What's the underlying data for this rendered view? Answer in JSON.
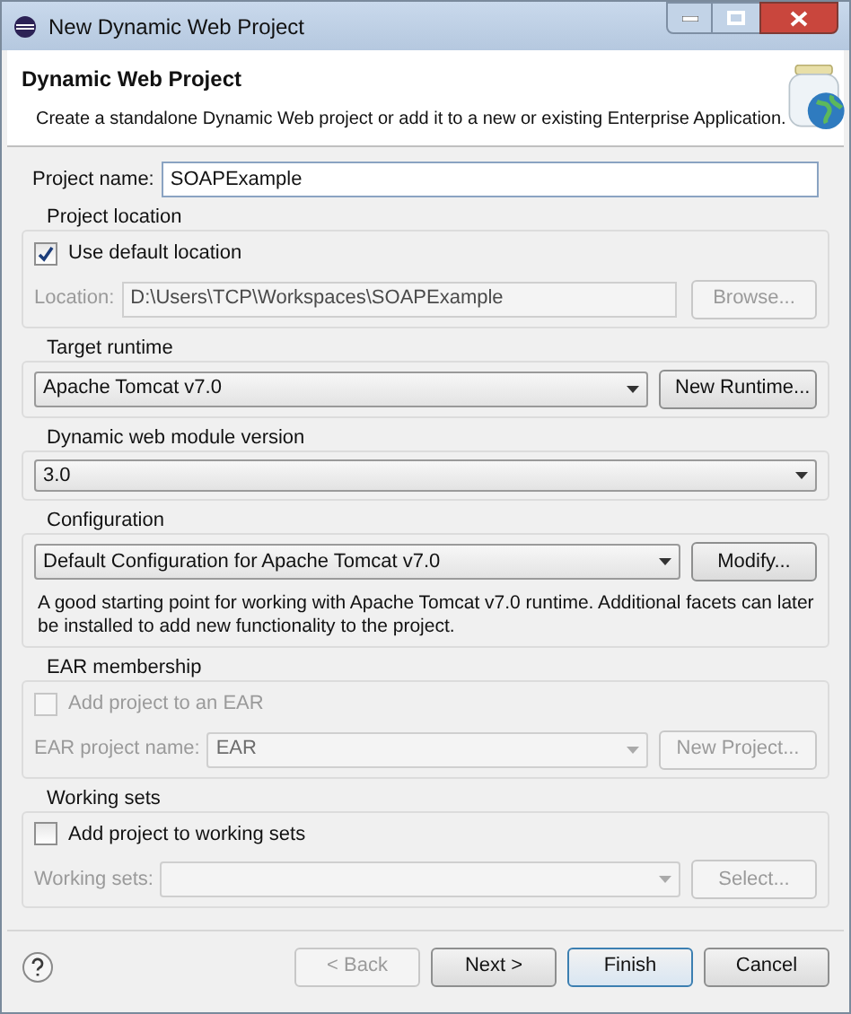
{
  "window": {
    "title": "New Dynamic Web Project"
  },
  "banner": {
    "title": "Dynamic Web Project",
    "description": "Create a standalone Dynamic Web project or add it to a new or existing Enterprise Application."
  },
  "project_name": {
    "label": "Project name:",
    "value": "SOAPExample"
  },
  "project_location": {
    "legend": "Project location",
    "use_default": {
      "label": "Use default location",
      "checked": true
    },
    "location": {
      "label": "Location:",
      "value": "D:\\Users\\TCP\\Workspaces\\SOAPExample",
      "disabled": true
    },
    "button": {
      "label": "Browse...",
      "disabled": true
    }
  },
  "target_runtime": {
    "legend": "Target runtime",
    "value": "Apache Tomcat v7.0",
    "button": {
      "label": "New Runtime...",
      "disabled": false
    }
  },
  "module_version": {
    "legend": "Dynamic web module version",
    "value": "3.0"
  },
  "configuration": {
    "legend": "Configuration",
    "value": "Default Configuration for Apache Tomcat v7.0",
    "button": {
      "label": "Modify...",
      "disabled": false
    },
    "description": "A good starting point for working with Apache Tomcat v7.0 runtime. Additional facets can later be installed to add new functionality to the project."
  },
  "ear_membership": {
    "legend": "EAR membership",
    "add": {
      "label": "Add project to an EAR",
      "checked": false,
      "disabled": true
    },
    "project_name": {
      "label": "EAR project name:",
      "value": "EAR",
      "disabled": true
    },
    "button": {
      "label": "New Project...",
      "disabled": true
    }
  },
  "working_sets": {
    "legend": "Working sets",
    "add": {
      "label": "Add project to working sets",
      "checked": false,
      "disabled": false
    },
    "field": {
      "label": "Working sets:",
      "disabled": true
    },
    "button": {
      "label": "Select...",
      "disabled": true
    }
  },
  "buttons": [
    {
      "label": "< Back",
      "disabled": true,
      "default": false
    },
    {
      "label": "Next >",
      "disabled": false,
      "default": false
    },
    {
      "label": "Finish",
      "disabled": false,
      "default": true
    },
    {
      "label": "Cancel",
      "disabled": false,
      "default": false
    }
  ]
}
